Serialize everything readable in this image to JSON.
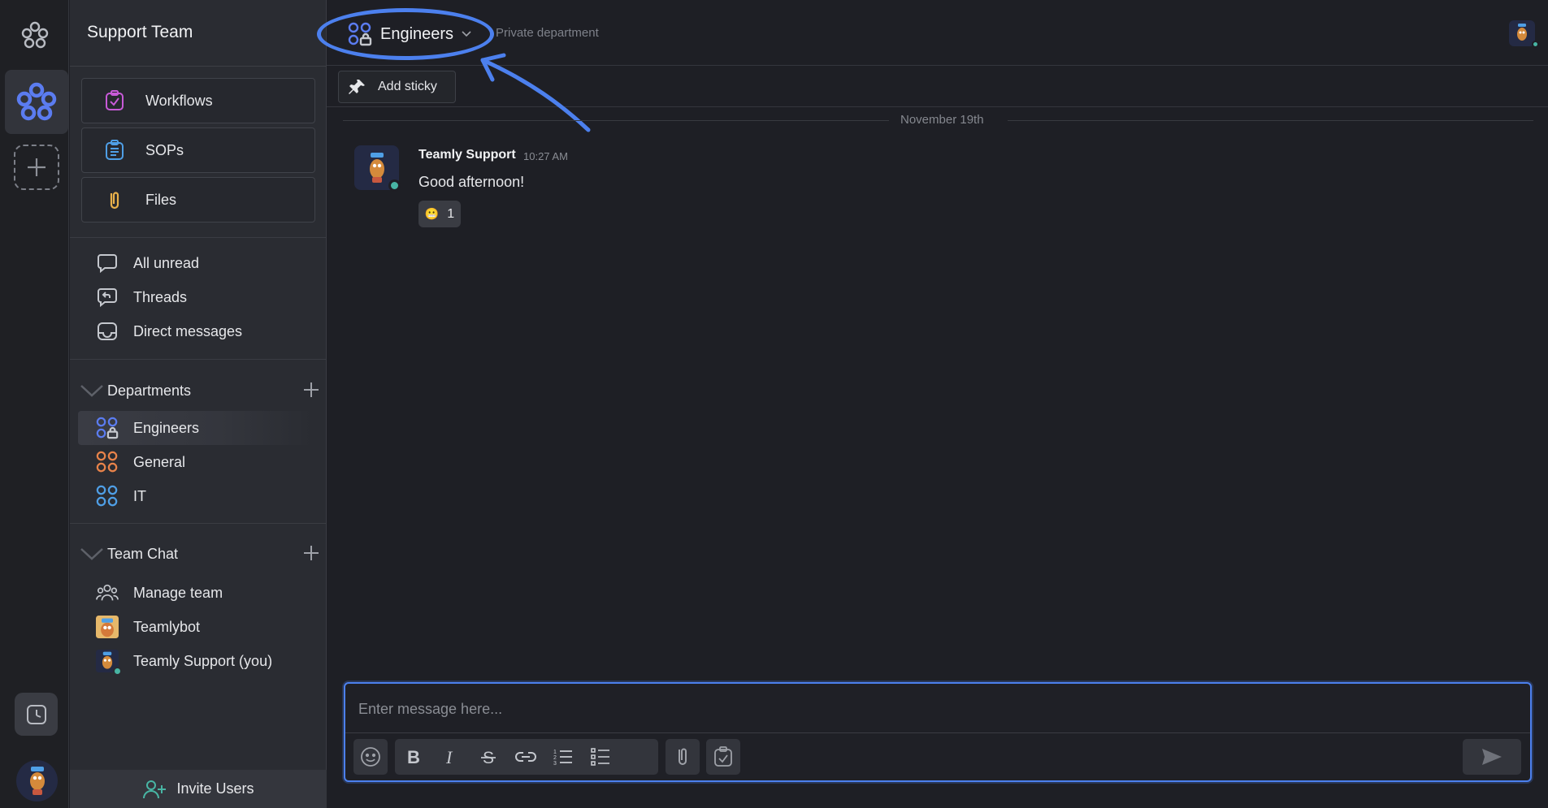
{
  "sidebar": {
    "team_name": "Support Team",
    "tools": [
      {
        "label": "Workflows",
        "icon": "workflows-icon"
      },
      {
        "label": "SOPs",
        "icon": "sops-icon"
      },
      {
        "label": "Files",
        "icon": "files-icon"
      }
    ],
    "nav": [
      {
        "label": "All unread",
        "icon": "chat-bubble-icon"
      },
      {
        "label": "Threads",
        "icon": "threads-icon"
      },
      {
        "label": "Direct messages",
        "icon": "inbox-icon"
      }
    ],
    "departments_label": "Departments",
    "departments": [
      {
        "label": "Engineers",
        "color": "#5b7cf0",
        "private": true,
        "active": true
      },
      {
        "label": "General",
        "color": "#e8834a"
      },
      {
        "label": "IT",
        "color": "#4f9fe6"
      }
    ],
    "team_chat_label": "Team Chat",
    "team_chat": [
      {
        "label": "Manage team",
        "icon": "team-icon"
      },
      {
        "label": "Teamlybot",
        "icon": "bot-avatar"
      },
      {
        "label": "Teamly Support (you)",
        "icon": "user-avatar"
      }
    ],
    "invite_label": "Invite Users"
  },
  "header": {
    "department": "Engineers",
    "subtitle": "Private department",
    "add_sticky": "Add sticky"
  },
  "messages": {
    "date_divider": "November 19th",
    "items": [
      {
        "author": "Teamly Support",
        "time": "10:27 AM",
        "text": "Good afternoon!",
        "reaction_emoji": "😬",
        "reaction_count": "1"
      }
    ]
  },
  "composer": {
    "placeholder": "Enter message here...",
    "toolbar": [
      "emoji-icon",
      "bold-icon",
      "italic-icon",
      "strikethrough-icon",
      "link-icon",
      "ordered-list-icon",
      "bullet-list-icon",
      "attach-icon",
      "task-icon",
      "send-icon"
    ]
  },
  "colors": {
    "accent": "#4c80ee",
    "online": "#48b5a4",
    "workflows": "#c85ad8",
    "sops": "#4f9fe6",
    "files": "#e8b04a"
  }
}
